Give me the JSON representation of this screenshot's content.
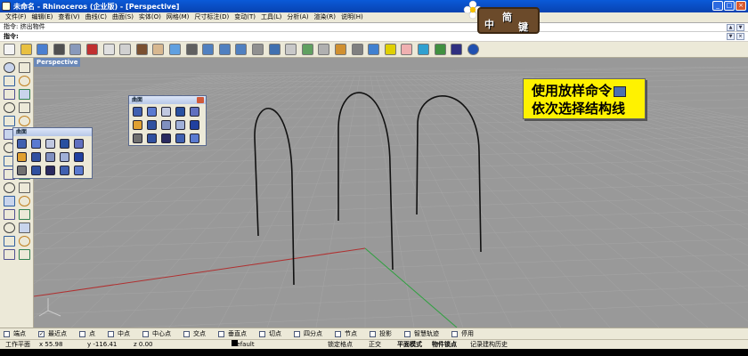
{
  "window": {
    "title": "未命名 - Rhinoceros (企业版) - [Perspective]"
  },
  "menu": [
    "文件(F)",
    "编辑(E)",
    "查看(V)",
    "曲线(C)",
    "曲面(S)",
    "实体(O)",
    "网格(M)",
    "尺寸标注(D)",
    "变动(T)",
    "工具(L)",
    "分析(A)",
    "渲染(R)",
    "说明(H)"
  ],
  "command": {
    "history": "指令: 挤出物件",
    "prompt": "指令:"
  },
  "logo": {
    "chars": [
      "中",
      "简",
      "键"
    ]
  },
  "viewport": {
    "tab": "Perspective"
  },
  "panels": {
    "surface_title_1": "曲面",
    "surface_title_2": "曲面"
  },
  "note": {
    "line1": "使用放样命令",
    "line2": "依次选择结构线"
  },
  "osnap": [
    {
      "label": "端点",
      "checked": false
    },
    {
      "label": "最近点",
      "checked": true
    },
    {
      "label": "点",
      "checked": false
    },
    {
      "label": "中点",
      "checked": false
    },
    {
      "label": "中心点",
      "checked": false
    },
    {
      "label": "交点",
      "checked": false
    },
    {
      "label": "垂直点",
      "checked": false
    },
    {
      "label": "切点",
      "checked": false
    },
    {
      "label": "四分点",
      "checked": false
    },
    {
      "label": "节点",
      "checked": false
    },
    {
      "label": "投影",
      "checked": false
    },
    {
      "label": "智慧轨迹",
      "checked": false
    },
    {
      "label": "停用",
      "checked": false
    }
  ],
  "status": {
    "plane": "工作平面",
    "x": "x 55.98",
    "y": "y -116.41",
    "z": "z 0.00",
    "layer": "Default",
    "grid_snap": "锁定格点",
    "ortho": "正交",
    "planar": "平面模式",
    "osnap": "物件锁点",
    "history": "记录建构历史"
  },
  "colors": {
    "viewport_bg": "#999999",
    "grid_line": "#a6a6a6",
    "x_axis": "#b03030",
    "y_axis": "#30a040",
    "curve": "#111111",
    "note_bg": "#fff200"
  }
}
